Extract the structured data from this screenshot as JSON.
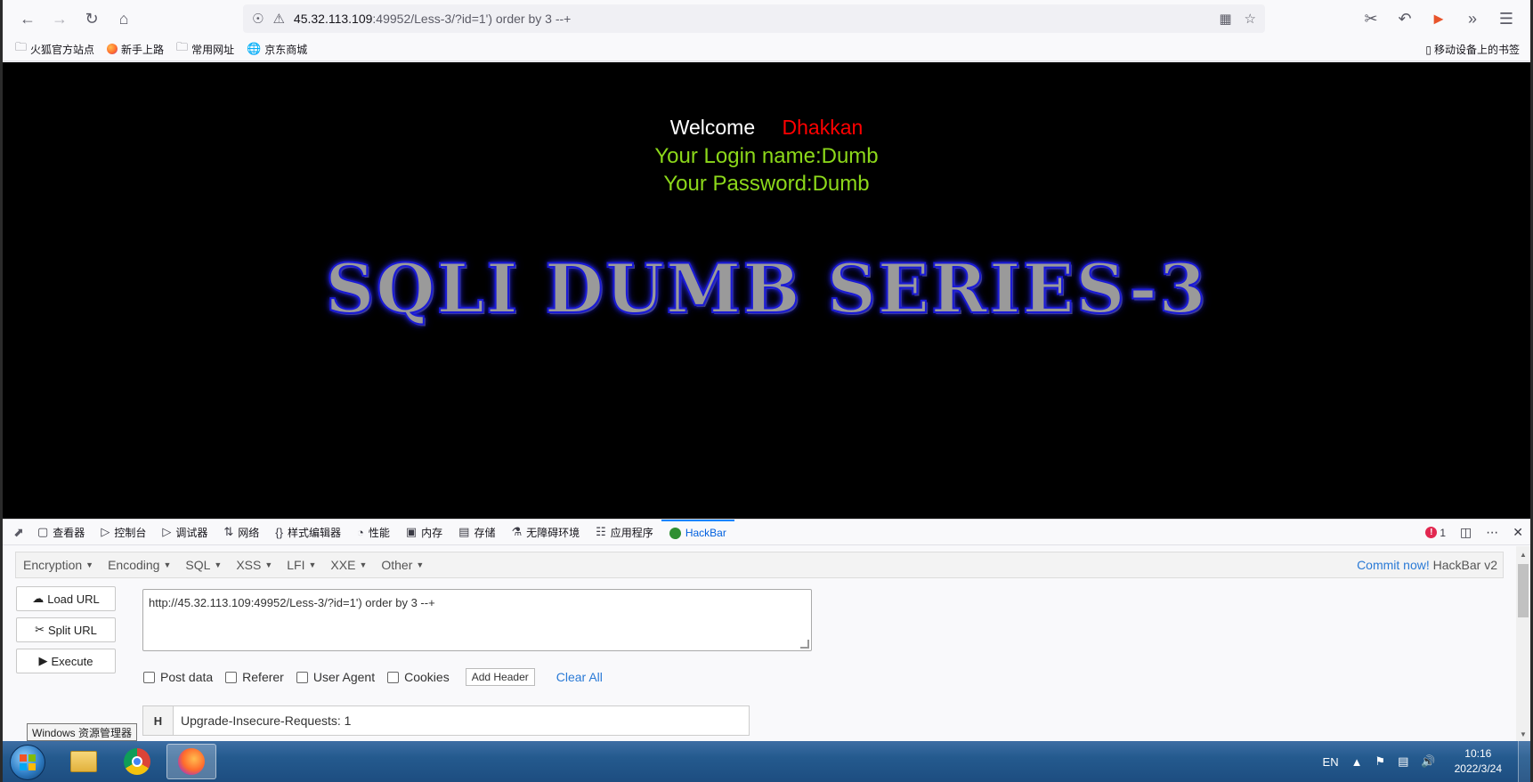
{
  "browser": {
    "url_host": "45.32.113.109",
    "url_rest": ":49952/Less-3/?id=1') order by 3 --+",
    "bookmarks": [
      "火狐官方站点",
      "新手上路",
      "常用网址",
      "京东商城"
    ],
    "mobile_bookmarks": "移动设备上的书签"
  },
  "page": {
    "welcome_label": "Welcome",
    "welcome_name": "Dhakkan",
    "login_name": "Your Login name:Dumb",
    "password": "Your Password:Dumb",
    "series_title": "SQLI DUMB SERIES-3"
  },
  "devtools": {
    "tabs": [
      "查看器",
      "控制台",
      "调试器",
      "网络",
      "样式编辑器",
      "性能",
      "内存",
      "存储",
      "无障碍环境",
      "应用程序",
      "HackBar"
    ],
    "error_count": "1"
  },
  "hackbar": {
    "menus": [
      "Encryption",
      "Encoding",
      "SQL",
      "XSS",
      "LFI",
      "XXE",
      "Other"
    ],
    "commit_link": "Commit now!",
    "version": "HackBar v2",
    "buttons": [
      "Load URL",
      "Split URL",
      "Execute"
    ],
    "url_value": "http://45.32.113.109:49952/Less-3/?id=1') order by 3 --+",
    "options": [
      "Post data",
      "Referer",
      "User Agent",
      "Cookies"
    ],
    "add_header": "Add Header",
    "clear_all": "Clear All",
    "header_key": "H",
    "header_value": "Upgrade-Insecure-Requests: 1"
  },
  "os": {
    "tooltip": "Windows 资源管理器",
    "lang": "EN",
    "time": "10:16",
    "date": "2022/3/24"
  }
}
